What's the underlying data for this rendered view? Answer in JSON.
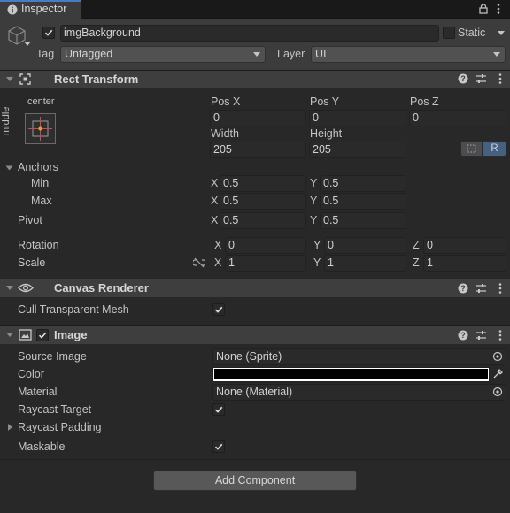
{
  "tab": {
    "label": "Inspector"
  },
  "gameobject": {
    "name": "imgBackground",
    "static_label": "Static",
    "tag_label": "Tag",
    "tag_value": "Untagged",
    "layer_label": "Layer",
    "layer_value": "UI"
  },
  "rect_transform": {
    "title": "Rect Transform",
    "anchor_preset": {
      "top_label": "center",
      "side_label": "middle"
    },
    "headers": {
      "pos_x": "Pos X",
      "pos_y": "Pos Y",
      "pos_z": "Pos Z",
      "width": "Width",
      "height": "Height"
    },
    "values": {
      "pos_x": "0",
      "pos_y": "0",
      "pos_z": "0",
      "width": "205",
      "height": "205"
    },
    "r_button": "R",
    "anchors_label": "Anchors",
    "min_label": "Min",
    "max_label": "Max",
    "min_x": "0.5",
    "min_y": "0.5",
    "max_x": "0.5",
    "max_y": "0.5",
    "pivot_label": "Pivot",
    "pivot_x": "0.5",
    "pivot_y": "0.5",
    "rotation_label": "Rotation",
    "rot_x": "0",
    "rot_y": "0",
    "rot_z": "0",
    "scale_label": "Scale",
    "scale_x": "1",
    "scale_y": "1",
    "scale_z": "1",
    "axis_x": "X",
    "axis_y": "Y",
    "axis_z": "Z"
  },
  "canvas_renderer": {
    "title": "Canvas Renderer",
    "cull_label": "Cull Transparent Mesh"
  },
  "image": {
    "title": "Image",
    "source_image_label": "Source Image",
    "source_image_value": "None (Sprite)",
    "color_label": "Color",
    "material_label": "Material",
    "material_value": "None (Material)",
    "raycast_target_label": "Raycast Target",
    "raycast_padding_label": "Raycast Padding",
    "maskable_label": "Maskable"
  },
  "add_component": "Add Component",
  "colors": {
    "accent": "#4b7ac5",
    "image_color": "#000000"
  }
}
